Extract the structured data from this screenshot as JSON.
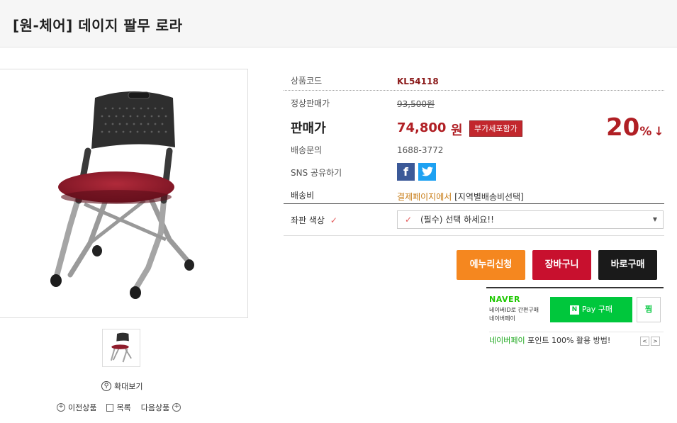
{
  "product": {
    "title": "[원-체어] 데이지 팔무 로라"
  },
  "gallery": {
    "zoom_label": "확대보기",
    "prev_label": "이전상품",
    "list_label": "목록",
    "next_label": "다음상품"
  },
  "info": {
    "code_label": "상품코드",
    "code_value": "KL54118",
    "list_price_label": "정상판매가",
    "list_price_value": "93,500원",
    "sale_price_label": "판매가",
    "sale_price_value": "74,800",
    "sale_price_unit": "원",
    "vat_badge": "부가세포함가",
    "discount_num": "20",
    "discount_pct": "%",
    "discount_arrow": "↓",
    "inquiry_label": "배송문의",
    "inquiry_value": "1688-3772",
    "sns_label": "SNS 공유하기",
    "shipping_label": "배송비",
    "shipping_value_link": "결제페이지에서",
    "shipping_value_rest": "[지역별배송비선택]"
  },
  "option": {
    "label": "좌판 색상",
    "check": "✓",
    "select_value": "(필수) 선택 하세요!!"
  },
  "buttons": {
    "enuri": "에누리신청",
    "cart": "장바구니",
    "buy": "바로구매"
  },
  "naver": {
    "logo": "NAVER",
    "small_line1": "네이버ID로 간편구매",
    "small_line2": "네이버페이",
    "npay_label": "Pay 구매",
    "npay_n": "N",
    "zzim_label": "찜",
    "point_green": "네이버페이",
    "point_rest": "포인트 100% 활용 방법!",
    "prev": "<",
    "next": ">"
  },
  "icons": [
    "search-icon",
    "plus-icon",
    "list-icon",
    "facebook-icon",
    "twitter-icon",
    "check-icon",
    "chevron-down-icon"
  ],
  "colors": {
    "accent_red": "#b01f24",
    "enuri_orange": "#f5871f",
    "cart_red": "#c8102e",
    "buy_black": "#1a1a1a",
    "naver_green": "#00c73c",
    "facebook_blue": "#3b5998",
    "twitter_blue": "#1da1f2"
  }
}
